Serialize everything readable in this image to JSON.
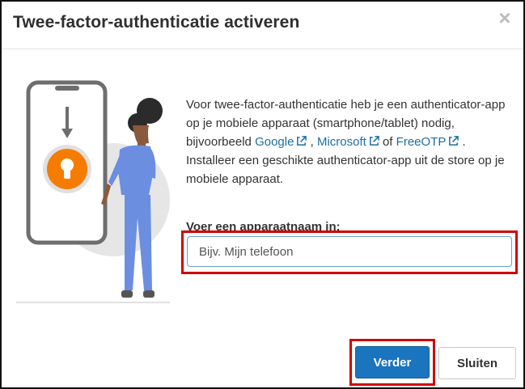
{
  "dialog": {
    "title": "Twee-factor-authenticatie activeren",
    "close_icon": "close-icon"
  },
  "description": {
    "text_1": "Voor twee-factor-authenticatie heb je een authenticator-app op je mobiele apparaat (smartphone/tablet) nodig, bijvoorbeeld ",
    "link_google": "Google",
    "sep_1": " , ",
    "link_microsoft": "Microsoft",
    "sep_2": "  of ",
    "link_freeotp": "FreeOTP",
    "text_2": " . Installeer een geschikte authenticator-app uit de store op je mobiele apparaat."
  },
  "device_name": {
    "label": "Voer een apparaatnaam in:",
    "placeholder": "Bijv. Mijn telefoon",
    "value": ""
  },
  "buttons": {
    "next": "Verder",
    "close": "Sluiten"
  },
  "colors": {
    "primary": "#1b74be",
    "link": "#1c6ea4",
    "highlight": "#d10000",
    "lock": "#f57c00",
    "figure": "#6b8ee0"
  }
}
